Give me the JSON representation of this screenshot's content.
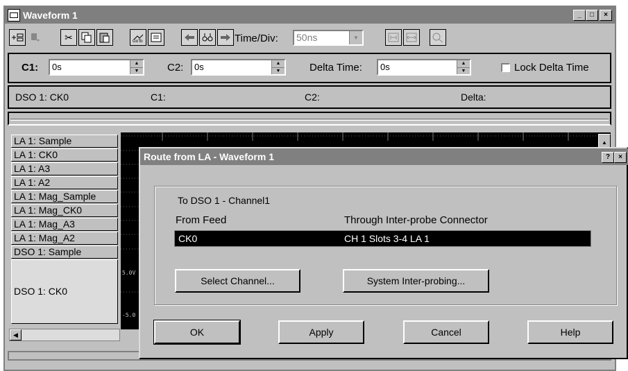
{
  "window": {
    "title": "Waveform 1",
    "controls": {
      "minimize": "_",
      "maximize": "□",
      "close": "×"
    }
  },
  "toolbar": {
    "icons": [
      "add-channel-icon",
      "channel-down-icon",
      "cut-icon",
      "copy-icon",
      "paste-icon",
      "goto-icon",
      "properties-icon",
      "back-icon",
      "find-icon",
      "forward-icon",
      "zoom-fit-icon",
      "zoom-range-icon",
      "zoom-icon"
    ],
    "timediv_label": "Time/Div:",
    "timediv_value": "50ns"
  },
  "cursors": {
    "c1_label": "C1:",
    "c1_value": "0s",
    "c2_label": "C2:",
    "c2_value": "0s",
    "delta_label": "Delta Time:",
    "delta_value": "0s",
    "lock_label": "Lock Delta Time",
    "lock_checked": false
  },
  "measure": {
    "channel": "DSO 1: CK0",
    "c1": "C1:",
    "c2": "C2:",
    "delta": "Delta:"
  },
  "channels": [
    "LA 1: Sample",
    "LA 1: CK0",
    "LA 1: A3",
    "LA 1: A2",
    "LA 1: Mag_Sample",
    "LA 1: Mag_CK0",
    "LA 1: Mag_A3",
    "LA 1: Mag_A2",
    "DSO 1: Sample",
    "DSO 1: CK0"
  ],
  "waveform_axis": {
    "top": "5.0V",
    "bottom": "-5.0"
  },
  "dialog": {
    "title": "Route from LA - Waveform 1",
    "help_glyph": "?",
    "close_glyph": "×",
    "to_label": "To DSO 1 - Channel1",
    "col_from": "From Feed",
    "col_through": "Through Inter-probe Connector",
    "row_from": "CK0",
    "row_through": "CH 1 Slots 3-4 LA 1",
    "select_channel": "Select Channel...",
    "system_interprobing": "System Inter-probing...",
    "ok": "OK",
    "apply": "Apply",
    "cancel": "Cancel",
    "help": "Help"
  }
}
